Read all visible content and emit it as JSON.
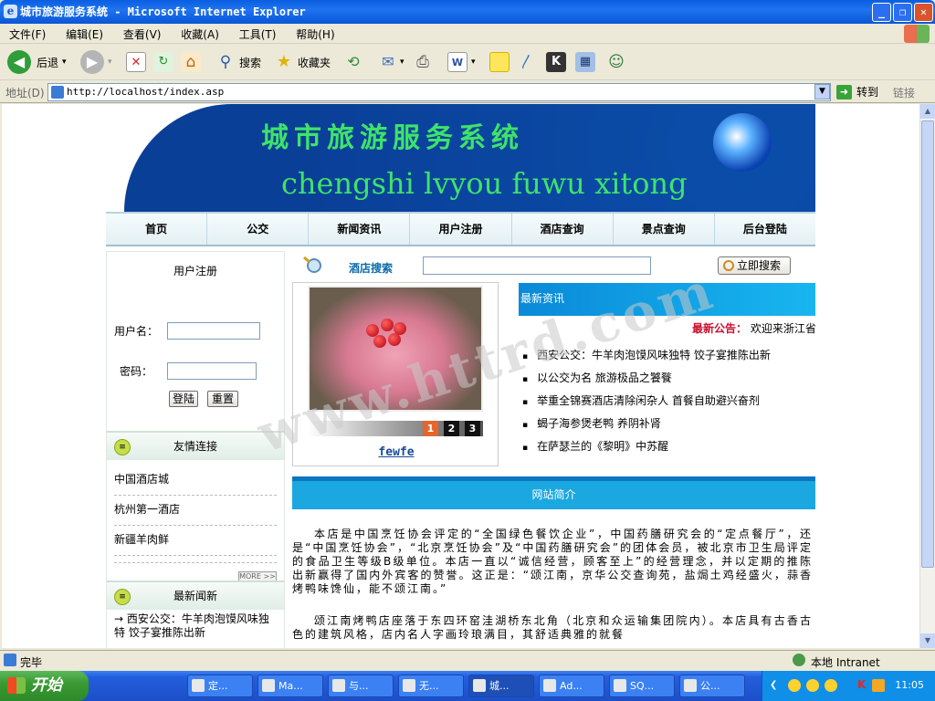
{
  "window": {
    "title": "城市旅游服务系统 - Microsoft Internet Explorer",
    "app_glyph": "e",
    "min_glyph": "_",
    "max_glyph": "❐",
    "close_glyph": "✕"
  },
  "menu": {
    "items": [
      "文件(F)",
      "编辑(E)",
      "查看(V)",
      "收藏(A)",
      "工具(T)",
      "帮助(H)"
    ]
  },
  "toolbar": {
    "back": "后退",
    "search": "搜索",
    "favorites": "收藏夹",
    "back_glyph": "◀",
    "forward_glyph": "▶",
    "stop_glyph": "✕",
    "refresh_glyph": "↻",
    "home_glyph": "⌂",
    "search_glyph": "⚲",
    "favorites_glyph": "★",
    "history_glyph": "⟲",
    "mail_glyph": "✉",
    "print_glyph": "⎙",
    "edit_glyph": "W",
    "dropdown_glyph": "▾",
    "users_glyph": "☺"
  },
  "address": {
    "label": "地址(D)",
    "url": "http://localhost/index.asp",
    "go": "转到",
    "links": "链接",
    "go_glyph": "➜",
    "dropdown_glyph": "▼"
  },
  "banner": {
    "title": "城市旅游服务系统",
    "pinyin": "chengshi lvyou fuwu xitong"
  },
  "nav": [
    "首页",
    "公交",
    "新闻资讯",
    "用户注册",
    "酒店查询",
    "景点查询",
    "后台登陆"
  ],
  "login": {
    "title": "用户注册",
    "username_label": "用户名：",
    "password_label": "密码：",
    "login_button": "登陆",
    "reset_button": "重置"
  },
  "friend_links": {
    "title": "友情连接",
    "items": [
      "中国酒店城",
      "杭州第一酒店",
      "新疆羊肉鲜"
    ],
    "more": "MORE >>"
  },
  "latest_news_left": {
    "title": "最新闻新",
    "items": [
      "→ 西安公交：牛羊肉泡馍风味独特 饺子宴推陈出新"
    ]
  },
  "hotel_search": {
    "label": "酒店搜索",
    "button": "立即搜索"
  },
  "slideshow": {
    "pages": [
      "1",
      "2",
      "3"
    ],
    "active_page": 1,
    "caption": "fewfe"
  },
  "news_panel": {
    "title": "最新资讯",
    "announcement_label": "最新公告：",
    "announcement_text": "欢迎来浙江省",
    "items": [
      "西安公交：牛羊肉泡馍风味独特 饺子宴推陈出新",
      "以公交为名 旅游极品之饕餮",
      "举重全锦赛酒店清除闲杂人 首餐自助避兴奋剂",
      "蝎子海参煲老鸭 养阴补肾",
      "在萨瑟兰的《黎明》中苏醒"
    ]
  },
  "intro": {
    "title": "网站简介",
    "paragraphs": [
      "本店是中国烹饪协会评定的“全国绿色餐饮企业”，中国药膳研究会的“定点餐厅”，还是“中国烹饪协会”，“北京烹饪协会”及“中国药膳研究会”的团体会员，被北京市卫生局评定的食品卫生等级B级单位。本店一直以“诚信经营，顾客至上”的经营理念，并以定期的推陈出新赢得了国内外宾客的赞誉。这正是：“颂江南，京华公交查询苑，盐焗土鸡经盛火，蒜香烤鸭味馋仙，能不颂江南。”",
      "颂江南烤鸭店座落于东四环窑洼湖桥东北角（北京和众运输集团院内）。本店具有古香古色的建筑风格，店内名人字画玲琅满目，其舒适典雅的就餐"
    ]
  },
  "watermark": "www.httrd.com",
  "status": {
    "text": "完毕",
    "zone": "本地 Intranet"
  },
  "taskbar": {
    "start": "开始",
    "tasks": [
      "定...",
      "Ma...",
      "与...",
      "无...",
      "城...",
      "Ad...",
      "SQ...",
      "公..."
    ],
    "clock": "11:05"
  }
}
